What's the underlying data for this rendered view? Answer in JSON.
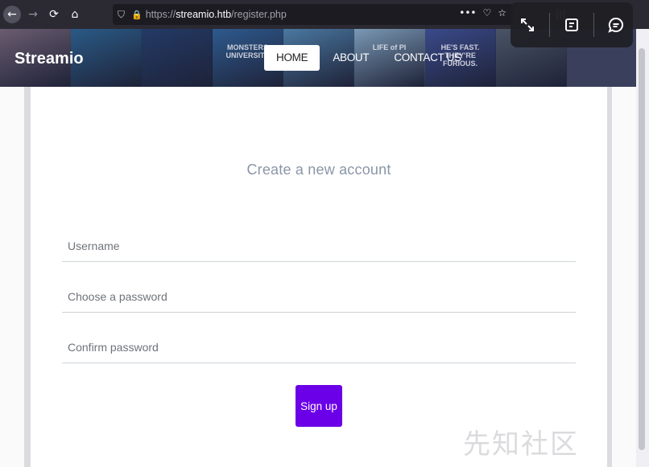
{
  "browser": {
    "url_scheme": "https://",
    "url_host": "streamio.htb",
    "url_path": "/register.php",
    "more_label": "•••"
  },
  "site": {
    "brand": "Streamio",
    "menu": [
      {
        "label": "HOME",
        "active": true
      },
      {
        "label": "ABOUT",
        "active": false
      },
      {
        "label": "CONTACT US",
        "active": false
      }
    ],
    "posters": [
      {
        "caption": "",
        "color": "#6b5c70"
      },
      {
        "caption": "",
        "color": "#2a5a86"
      },
      {
        "caption": "",
        "color": "#233a66"
      },
      {
        "caption": "MONSTERS UNIVERSITY",
        "color": "#2e5a8e"
      },
      {
        "caption": "",
        "color": "#4a78a0"
      },
      {
        "caption": "LIFE of PI",
        "color": "#7a98b4"
      },
      {
        "caption": "HE'S FAST. THEY'RE FURIOUS.",
        "color": "#3a4a8a"
      },
      {
        "caption": "",
        "color": "#4a5466"
      }
    ]
  },
  "form": {
    "heading": "Create a new account",
    "username_placeholder": "Username",
    "password_placeholder": "Choose a password",
    "confirm_placeholder": "Confirm password",
    "submit_label": "Sign up"
  },
  "watermark": "先知社区"
}
